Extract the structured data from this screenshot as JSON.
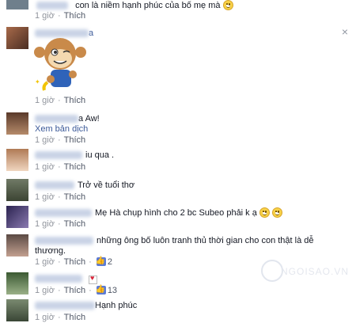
{
  "comments": [
    {
      "text": "con là niềm hạnh phúc của bố mẹ mà",
      "time": "1 giờ",
      "like": "Thích"
    },
    {
      "text": "a",
      "time": "1 giờ",
      "like": "Thích"
    },
    {
      "text": "a Aw!",
      "translate": "Xem bản dịch",
      "time": "1 giờ",
      "like": "Thích"
    },
    {
      "text": "iu qua .",
      "time": "1 giờ",
      "like": "Thích"
    },
    {
      "text": "Trở về tuổi thơ",
      "time": "1 giờ",
      "like": "Thích"
    },
    {
      "text": "Mẹ Hà chụp hình cho 2 bc Subeo phải k ạ",
      "time": "1 giờ",
      "like": "Thích"
    },
    {
      "text_line1": "những ông bố luôn tranh thủ thời gian cho con thật là dễ",
      "text_line2": "thương.",
      "time": "1 giờ",
      "like": "Thích",
      "like_count": "2"
    },
    {
      "time": "1 giờ",
      "like": "Thích",
      "like_count": "13"
    },
    {
      "text": "Hạnh phúc",
      "time": "1 giờ",
      "like": "Thích"
    }
  ],
  "close_symbol": "×",
  "separator": "·",
  "watermark": "NGOISAO.VN",
  "colors": {
    "link": "#3b5998",
    "meta": "#90949c"
  }
}
